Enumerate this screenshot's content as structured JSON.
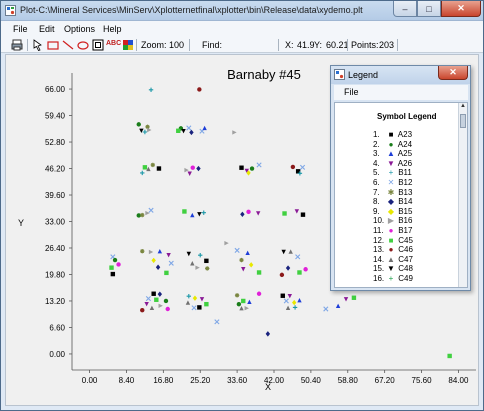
{
  "window": {
    "title": "Plot-C:\\Mineral Services\\MinServ\\Xplotternetfinal\\xplotter\\bin\\Release\\data\\xydemo.plt",
    "minimize": "–",
    "maximize": "□",
    "close": "✕"
  },
  "menu": [
    "File",
    "Edit",
    "Options",
    "Help"
  ],
  "toolbar": {
    "zoom_label": "Zoom:",
    "zoom_value": "100",
    "find_label": "Find:",
    "x_label": "X:",
    "x_value": "41.9",
    "y_label": "Y:",
    "y_value": "60.21",
    "points_label": "Points:",
    "points_value": "203",
    "text_tool": "ABC"
  },
  "chart_data": {
    "type": "scatter",
    "title": "Barnaby #45",
    "xlabel": "X",
    "ylabel": "Y",
    "xlim": [
      -4,
      88
    ],
    "ylim": [
      -4,
      70
    ],
    "x_ticks": [
      "0.00",
      "8.40",
      "16.80",
      "25.20",
      "33.60",
      "42.00",
      "50.40",
      "58.80",
      "67.20",
      "75.60",
      "84.00"
    ],
    "y_ticks": [
      "66.00",
      "59.40",
      "52.80",
      "46.20",
      "39.60",
      "33.00",
      "26.40",
      "19.80",
      "13.20",
      "6.60",
      "0.00"
    ],
    "grid": false,
    "points": [
      {
        "x": 14.0,
        "y": 65.8,
        "s": 5
      },
      {
        "x": 25.0,
        "y": 65.9,
        "s": 13
      },
      {
        "x": 11.2,
        "y": 57.2,
        "s": 2
      },
      {
        "x": 13.2,
        "y": 56.6,
        "s": 7
      },
      {
        "x": 11.8,
        "y": 55.6,
        "s": 15
      },
      {
        "x": 13.6,
        "y": 55.8,
        "s": 10
      },
      {
        "x": 12.6,
        "y": 55.3,
        "s": 5
      },
      {
        "x": 20.8,
        "y": 56.2,
        "s": 2
      },
      {
        "x": 22.6,
        "y": 56.3,
        "s": 6
      },
      {
        "x": 21.4,
        "y": 55.5,
        "s": 15
      },
      {
        "x": 23.2,
        "y": 55.2,
        "s": 8
      },
      {
        "x": 20.2,
        "y": 55.6,
        "s": 12
      },
      {
        "x": 25.6,
        "y": 55.5,
        "s": 6
      },
      {
        "x": 26.2,
        "y": 56.3,
        "s": 3
      },
      {
        "x": 33.0,
        "y": 55.2,
        "s": 10
      },
      {
        "x": 12.6,
        "y": 46.5,
        "s": 12
      },
      {
        "x": 13.4,
        "y": 46.1,
        "s": 14
      },
      {
        "x": 14.4,
        "y": 47.1,
        "s": 7
      },
      {
        "x": 15.8,
        "y": 46.2,
        "s": 1
      },
      {
        "x": 12.0,
        "y": 45.1,
        "s": 5
      },
      {
        "x": 22.1,
        "y": 45.8,
        "s": 10
      },
      {
        "x": 23.5,
        "y": 46.4,
        "s": 11
      },
      {
        "x": 24.8,
        "y": 46.2,
        "s": 8
      },
      {
        "x": 22.8,
        "y": 44.9,
        "s": 4
      },
      {
        "x": 34.6,
        "y": 46.4,
        "s": 1
      },
      {
        "x": 35.8,
        "y": 45.6,
        "s": 4
      },
      {
        "x": 37.0,
        "y": 46.2,
        "s": 2
      },
      {
        "x": 36.2,
        "y": 45.1,
        "s": 9
      },
      {
        "x": 38.6,
        "y": 47.1,
        "s": 6
      },
      {
        "x": 46.3,
        "y": 46.6,
        "s": 13
      },
      {
        "x": 47.5,
        "y": 45.5,
        "s": 1
      },
      {
        "x": 48.5,
        "y": 46.5,
        "s": 6
      },
      {
        "x": 47.9,
        "y": 45.0,
        "s": 5
      },
      {
        "x": 59.8,
        "y": 46.0,
        "s": 1
      },
      {
        "x": 11.2,
        "y": 34.5,
        "s": 2
      },
      {
        "x": 12.0,
        "y": 34.6,
        "s": 7
      },
      {
        "x": 13.2,
        "y": 35.1,
        "s": 10
      },
      {
        "x": 14.0,
        "y": 35.8,
        "s": 6
      },
      {
        "x": 21.6,
        "y": 35.5,
        "s": 12
      },
      {
        "x": 23.4,
        "y": 34.6,
        "s": 3
      },
      {
        "x": 25.0,
        "y": 34.8,
        "s": 15
      },
      {
        "x": 26.0,
        "y": 35.2,
        "s": 5
      },
      {
        "x": 34.8,
        "y": 34.8,
        "s": 8
      },
      {
        "x": 36.2,
        "y": 35.4,
        "s": 11
      },
      {
        "x": 38.4,
        "y": 35.0,
        "s": 4
      },
      {
        "x": 44.4,
        "y": 35.0,
        "s": 12
      },
      {
        "x": 47.2,
        "y": 35.5,
        "s": 4
      },
      {
        "x": 48.6,
        "y": 34.7,
        "s": 1
      },
      {
        "x": 5.3,
        "y": 24.2,
        "s": 6
      },
      {
        "x": 5.8,
        "y": 23.4,
        "s": 2
      },
      {
        "x": 6.6,
        "y": 22.3,
        "s": 11
      },
      {
        "x": 5.0,
        "y": 21.5,
        "s": 12
      },
      {
        "x": 5.3,
        "y": 19.9,
        "s": 1
      },
      {
        "x": 12.0,
        "y": 25.6,
        "s": 7
      },
      {
        "x": 14.0,
        "y": 25.4,
        "s": 10
      },
      {
        "x": 16.0,
        "y": 25.6,
        "s": 3
      },
      {
        "x": 18.0,
        "y": 24.6,
        "s": 4
      },
      {
        "x": 14.6,
        "y": 23.3,
        "s": 9
      },
      {
        "x": 18.6,
        "y": 22.6,
        "s": 6
      },
      {
        "x": 15.6,
        "y": 21.6,
        "s": 8
      },
      {
        "x": 17.5,
        "y": 20.2,
        "s": 12
      },
      {
        "x": 22.6,
        "y": 24.9,
        "s": 15
      },
      {
        "x": 25.2,
        "y": 24.6,
        "s": 5
      },
      {
        "x": 26.6,
        "y": 23.2,
        "s": 1
      },
      {
        "x": 23.4,
        "y": 22.6,
        "s": 14
      },
      {
        "x": 24.6,
        "y": 21.5,
        "s": 10
      },
      {
        "x": 26.8,
        "y": 21.3,
        "s": 7
      },
      {
        "x": 31.2,
        "y": 27.6,
        "s": 10
      },
      {
        "x": 33.6,
        "y": 25.8,
        "s": 6
      },
      {
        "x": 36.0,
        "y": 25.2,
        "s": 3
      },
      {
        "x": 34.6,
        "y": 23.4,
        "s": 7
      },
      {
        "x": 36.8,
        "y": 22.2,
        "s": 9
      },
      {
        "x": 35.0,
        "y": 21.1,
        "s": 4
      },
      {
        "x": 38.6,
        "y": 20.3,
        "s": 12
      },
      {
        "x": 44.2,
        "y": 25.4,
        "s": 15
      },
      {
        "x": 45.8,
        "y": 25.5,
        "s": 14
      },
      {
        "x": 47.4,
        "y": 24.2,
        "s": 6
      },
      {
        "x": 45.2,
        "y": 21.4,
        "s": 8
      },
      {
        "x": 47.8,
        "y": 20.3,
        "s": 12
      },
      {
        "x": 49.2,
        "y": 21.1,
        "s": 11
      },
      {
        "x": 43.8,
        "y": 19.7,
        "s": 13
      },
      {
        "x": 14.6,
        "y": 15.0,
        "s": 1
      },
      {
        "x": 16.0,
        "y": 14.9,
        "s": 8
      },
      {
        "x": 13.4,
        "y": 13.8,
        "s": 6
      },
      {
        "x": 15.2,
        "y": 13.5,
        "s": 12
      },
      {
        "x": 17.4,
        "y": 13.2,
        "s": 2
      },
      {
        "x": 13.0,
        "y": 12.4,
        "s": 4
      },
      {
        "x": 14.2,
        "y": 11.5,
        "s": 14
      },
      {
        "x": 16.2,
        "y": 12.0,
        "s": 10
      },
      {
        "x": 12.0,
        "y": 10.9,
        "s": 13
      },
      {
        "x": 17.8,
        "y": 11.2,
        "s": 11
      },
      {
        "x": 22.6,
        "y": 14.4,
        "s": 5
      },
      {
        "x": 24.0,
        "y": 13.9,
        "s": 9
      },
      {
        "x": 25.6,
        "y": 13.6,
        "s": 4
      },
      {
        "x": 22.4,
        "y": 12.8,
        "s": 14
      },
      {
        "x": 26.6,
        "y": 12.4,
        "s": 12
      },
      {
        "x": 23.8,
        "y": 11.5,
        "s": 6
      },
      {
        "x": 25.0,
        "y": 11.6,
        "s": 1
      },
      {
        "x": 33.6,
        "y": 14.6,
        "s": 7
      },
      {
        "x": 35.0,
        "y": 13.2,
        "s": 12
      },
      {
        "x": 34.0,
        "y": 12.4,
        "s": 2
      },
      {
        "x": 36.4,
        "y": 13.0,
        "s": 3
      },
      {
        "x": 34.6,
        "y": 11.4,
        "s": 14
      },
      {
        "x": 35.8,
        "y": 11.4,
        "s": 10
      },
      {
        "x": 38.6,
        "y": 15.0,
        "s": 11
      },
      {
        "x": 44.0,
        "y": 14.5,
        "s": 1
      },
      {
        "x": 45.6,
        "y": 14.4,
        "s": 4
      },
      {
        "x": 44.8,
        "y": 13.2,
        "s": 6
      },
      {
        "x": 46.6,
        "y": 12.8,
        "s": 9
      },
      {
        "x": 45.2,
        "y": 11.5,
        "s": 14
      },
      {
        "x": 46.8,
        "y": 11.6,
        "s": 5
      },
      {
        "x": 47.8,
        "y": 13.4,
        "s": 3
      },
      {
        "x": 53.8,
        "y": 11.2,
        "s": 6
      },
      {
        "x": 56.6,
        "y": 12.0,
        "s": 3
      },
      {
        "x": 58.4,
        "y": 13.6,
        "s": 4
      },
      {
        "x": 60.2,
        "y": 14.0,
        "s": 12
      },
      {
        "x": 29.0,
        "y": 8.0,
        "s": 6
      },
      {
        "x": 40.6,
        "y": 5.0,
        "s": 8
      },
      {
        "x": 82.0,
        "y": -0.5,
        "s": 12
      }
    ]
  },
  "legend": {
    "window_title": "Legend",
    "menu_file": "File",
    "heading": "Symbol Legend",
    "items": [
      {
        "num": "1.",
        "glyph": "■",
        "color": "#000000",
        "label": "A23"
      },
      {
        "num": "2.",
        "glyph": "●",
        "color": "#1a7d1a",
        "label": "A24"
      },
      {
        "num": "3.",
        "glyph": "▲",
        "color": "#1e3ed8",
        "label": "A25"
      },
      {
        "num": "4.",
        "glyph": "▼",
        "color": "#8a1a96",
        "label": "A26"
      },
      {
        "num": "5.",
        "glyph": "+",
        "color": "#1b98a8",
        "label": "B11"
      },
      {
        "num": "6.",
        "glyph": "✕",
        "color": "#7fa7e6",
        "label": "B12"
      },
      {
        "num": "7.",
        "glyph": "✱",
        "color": "#7a8640",
        "label": "B13"
      },
      {
        "num": "8.",
        "glyph": "◆",
        "color": "#1a237e",
        "label": "B14"
      },
      {
        "num": "9.",
        "glyph": "◆",
        "color": "#e8e800",
        "label": "B15"
      },
      {
        "num": "10.",
        "glyph": "▶",
        "color": "#a0a0a0",
        "label": "B16"
      },
      {
        "num": "11.",
        "glyph": "●",
        "color": "#e020d8",
        "label": "B17"
      },
      {
        "num": "12.",
        "glyph": "■",
        "color": "#40d040",
        "label": "C45"
      },
      {
        "num": "13.",
        "glyph": "●",
        "color": "#8b1a1a",
        "label": "C46"
      },
      {
        "num": "14.",
        "glyph": "▲",
        "color": "#707070",
        "label": "C47"
      },
      {
        "num": "15.",
        "glyph": "▼",
        "color": "#000000",
        "label": "C48"
      },
      {
        "num": "16.",
        "glyph": "+",
        "color": "#1fa04c",
        "label": "C49"
      }
    ]
  }
}
